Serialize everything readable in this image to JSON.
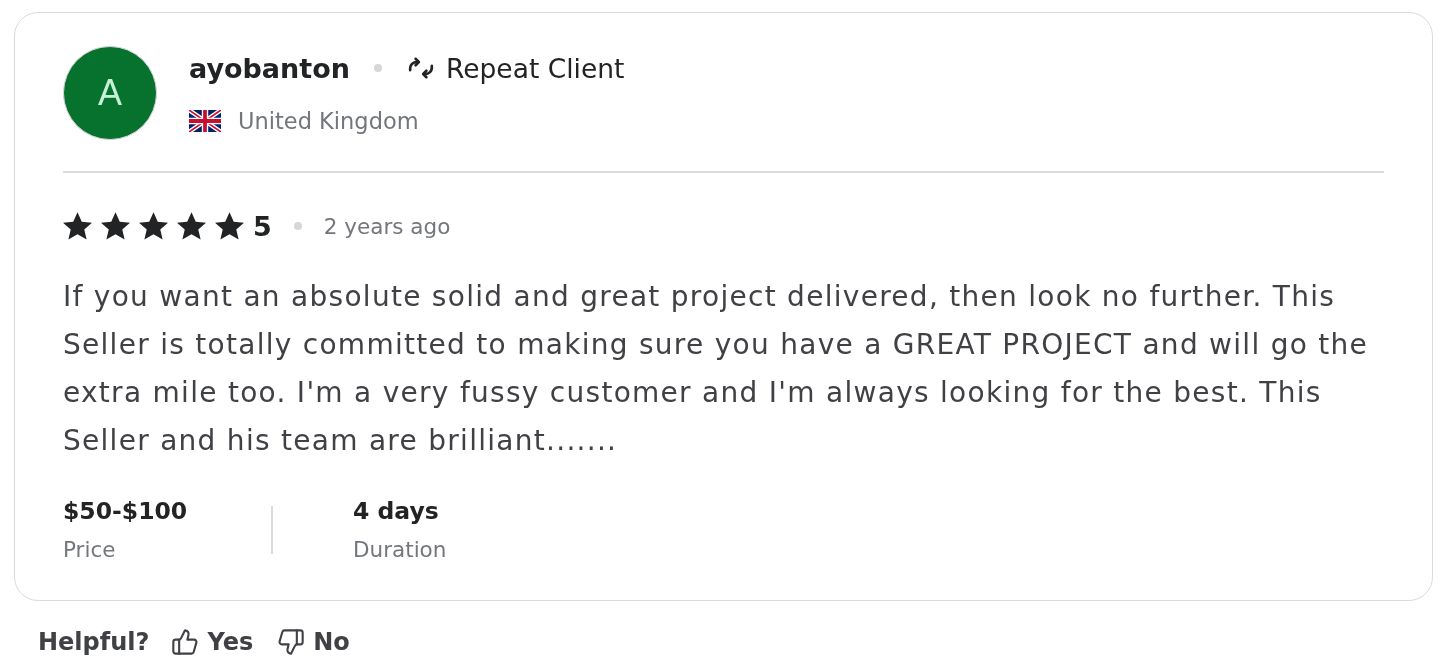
{
  "reviewer": {
    "avatar_letter": "A",
    "name": "ayobanton",
    "badge": "Repeat Client",
    "country": "United Kingdom"
  },
  "rating": {
    "stars": 5,
    "score": "5",
    "time": "2 years ago"
  },
  "review_text": "If you want an absolute solid and great project delivered, then look no further. This Seller is totally committed to making sure you have a GREAT PROJECT and will go the extra mile too. I'm a very fussy customer and I'm always looking for the best. This Seller and his team are brilliant.......",
  "details": [
    {
      "value": "$50-$100",
      "label": "Price"
    },
    {
      "value": "4 days",
      "label": "Duration"
    }
  ],
  "helpful": {
    "label": "Helpful?",
    "buttons": [
      {
        "kind": "up",
        "label": "Yes"
      },
      {
        "kind": "down",
        "label": "No"
      }
    ]
  }
}
